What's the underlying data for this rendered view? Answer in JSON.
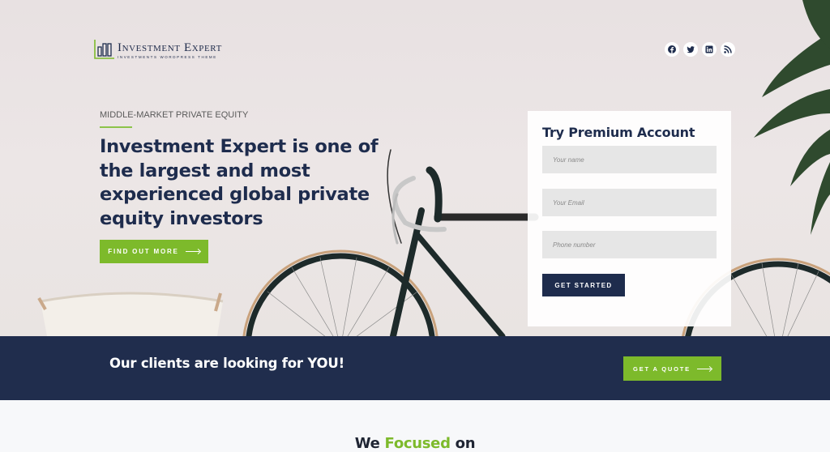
{
  "brand": {
    "title": "Investment Expert",
    "tagline": "Investments WordPress Theme",
    "accent_color": "#7dba2b",
    "navy_color": "#1e2c4d"
  },
  "socials": [
    {
      "name": "facebook",
      "icon": "facebook-icon"
    },
    {
      "name": "twitter",
      "icon": "twitter-icon"
    },
    {
      "name": "linkedin",
      "icon": "linkedin-icon"
    },
    {
      "name": "rss",
      "icon": "rss-icon"
    }
  ],
  "hero": {
    "eyebrow": "MIDDLE-MARKET PRIVATE EQUITY",
    "headline": "Investment Expert is one of the largest and most experienced global private equity investors",
    "cta_label": "Find out more"
  },
  "form": {
    "title": "Try Premium Account",
    "fields": [
      {
        "placeholder": "Your name",
        "value": ""
      },
      {
        "placeholder": "Your Email",
        "value": ""
      },
      {
        "placeholder": "Phone number",
        "value": ""
      }
    ],
    "submit_label": "Get started"
  },
  "cta_band": {
    "text": "Our clients are looking for YOU!",
    "button_label": "Get a quote"
  },
  "section": {
    "title_prefix": "We",
    "title_accent": "Focused",
    "title_suffix": "on"
  }
}
